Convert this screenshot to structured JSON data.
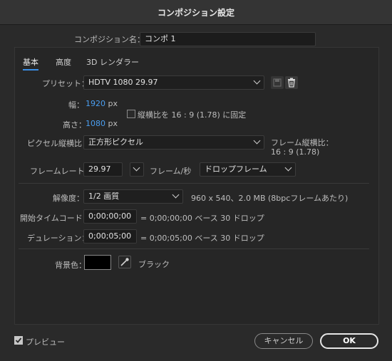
{
  "window": {
    "title": "コンポジション設定"
  },
  "comp_name": {
    "label": "コンポジション名：",
    "value": "コンポ 1"
  },
  "tabs": [
    {
      "label": "基本"
    },
    {
      "label": "高度"
    },
    {
      "label": "3D レンダラー"
    }
  ],
  "preset": {
    "label": "プリセット：",
    "value": "HDTV 1080 29.97"
  },
  "width": {
    "label": "幅：",
    "value": "1920",
    "unit": "px"
  },
  "height": {
    "label": "高さ：",
    "value": "1080",
    "unit": "px"
  },
  "lock_aspect": {
    "label": "縦横比を 16 : 9 (1.78) に固定",
    "checked": false
  },
  "pixel_aspect": {
    "label": "ピクセル縦横比：",
    "value": "正方形ピクセル"
  },
  "frame_aspect": {
    "label": "フレーム縦横比：",
    "value": "16 : 9 (1.78)"
  },
  "frame_rate": {
    "label": "フレームレート：",
    "value": "29.97",
    "unit": "フレーム/秒",
    "drop": "ドロップフレーム"
  },
  "resolution": {
    "label": "解像度：",
    "value": "1/2 画質",
    "info": "960 x 540、2.0 MB (8bpcフレームあたり)"
  },
  "start_timecode": {
    "label": "開始タイムコード：",
    "value": "0;00;00;00",
    "info": "= 0;00;00;00  ベース 30   ドロップ"
  },
  "duration": {
    "label": "デュレーション：",
    "value": "0;00;05;00",
    "info": "= 0;00;05;00  ベース 30   ドロップ"
  },
  "background": {
    "label": "背景色：",
    "color": "#000000",
    "name": "ブラック"
  },
  "footer": {
    "preview_label": "プレビュー",
    "preview_checked": true,
    "cancel": "キャンセル",
    "ok": "OK"
  },
  "colors": {
    "accent": "#3a8ee6",
    "link": "#4a9ef0",
    "dialog_bg": "#2a2a2a"
  },
  "icons": [
    "save-preset-icon",
    "trash-icon",
    "eyedropper-icon",
    "checkmark-icon",
    "chevron-down-icon"
  ]
}
